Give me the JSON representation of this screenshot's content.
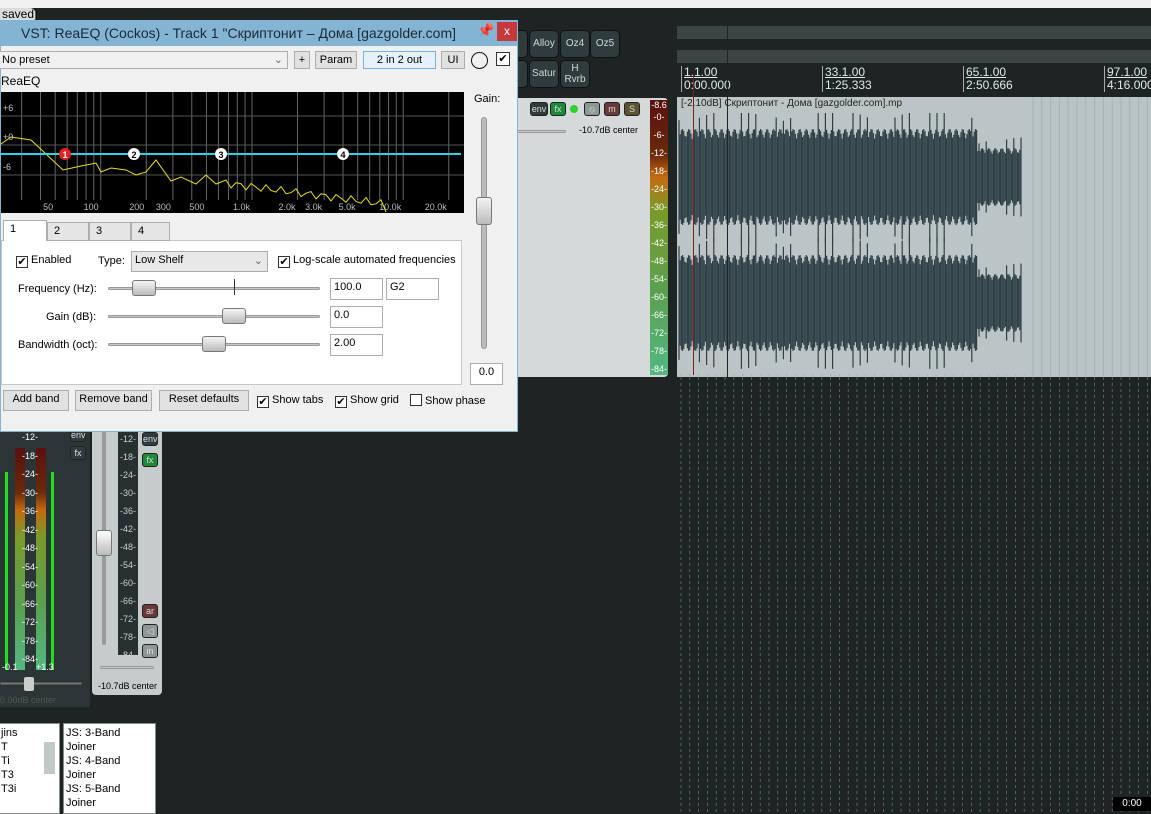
{
  "project_tab": "saved]",
  "vst": {
    "title": "VST: ReaEQ (Cockos) - Track 1 \"Скриптонит – Дома [gazgolder.com]",
    "close": "x",
    "preset": "No preset",
    "add": "+",
    "param": "Param",
    "io": "2 in 2 out",
    "ui": "UI",
    "group": "ReaEQ",
    "gain_label": "Gain:",
    "gain_value": "0.0",
    "graph": {
      "db_labels": [
        "+6",
        "+0",
        "-6"
      ],
      "freq_labels": [
        "50",
        "100",
        "200",
        "300",
        "500",
        "1.0k",
        "2.0k",
        "3.0k",
        "5.0k",
        "10.0k",
        "20.0k"
      ],
      "bands": [
        "1",
        "2",
        "3",
        "4"
      ],
      "selected_band": "1",
      "colors": {
        "eq_line": "#2ad4e8",
        "spectrum": "#e8e020",
        "selected": "#e82020"
      }
    },
    "tabs": [
      "1",
      "2",
      "3",
      "4"
    ],
    "enabled": "Enabled",
    "type_label": "Type:",
    "type_value": "Low Shelf",
    "logscale": "Log-scale automated frequencies",
    "frequency_label": "Frequency (Hz):",
    "frequency_value": "100.0",
    "note_value": "G2",
    "gain_db_label": "Gain (dB):",
    "gain_db_value": "0.0",
    "bandwidth_label": "Bandwidth (oct):",
    "bandwidth_value": "2.00",
    "add_band": "Add band",
    "remove_band": "Remove band",
    "reset": "Reset defaults",
    "show_tabs": "Show tabs",
    "show_grid": "Show grid",
    "show_phase": "Show phase",
    "checks": {
      "enabled": true,
      "logscale": true,
      "show_tabs": true,
      "show_grid": true,
      "show_phase": false
    }
  },
  "fx_buttons": [
    "Alloy",
    "Oz4",
    "Oz5",
    "Satur",
    "H Rvrb"
  ],
  "track": {
    "env": "env",
    "fx": "fx",
    "m": "m",
    "s": "S",
    "pan": "-10.7dB center",
    "peak": "-8.6",
    "meter_ticks": [
      "-0-",
      "-6-",
      "-12-",
      "-18-",
      "-24-",
      "-30-",
      "-36-",
      "-42-",
      "-48-",
      "-54-",
      "-60-",
      "-66-",
      "-72-",
      "-78-",
      "-84-"
    ]
  },
  "ruler": [
    {
      "bar": "1.1.00",
      "time": "0:00.000"
    },
    {
      "bar": "33.1.00",
      "time": "1:25.333"
    },
    {
      "bar": "65.1.00",
      "time": "2:50.666"
    },
    {
      "bar": "97.1.00",
      "time": "4:16.000"
    }
  ],
  "item_label": "[-2.10dB] Скриптонит - Дома [gazgolder.com].mp",
  "master": {
    "ticks": [
      "-12-",
      "-18-",
      "-24-",
      "-30-",
      "-36-",
      "-42-",
      "-48-",
      "-54-",
      "-60-",
      "-66-",
      "-72-",
      "-78-",
      "-84-"
    ],
    "left_peak": "-0.1",
    "right_peak": "+1.3",
    "pan": "0.00dB center",
    "env": "env",
    "fx": "fx"
  },
  "strip": {
    "ticks": [
      "-12-",
      "-18-",
      "-24-",
      "-30-",
      "-36-",
      "-42-",
      "-48-",
      "-54-",
      "-60-",
      "-66-",
      "-72-",
      "-78-",
      "-84-"
    ],
    "env": "env",
    "fx": "fx",
    "ar": "ar",
    "in": "in",
    "pan": "-10.7dB center"
  },
  "plugin_list": [
    "jins",
    "T",
    "Ti",
    "T3",
    "T3i"
  ],
  "js_list": [
    "JS: 3-Band Joiner",
    "JS: 4-Band Joiner",
    "JS: 5-Band Joiner"
  ],
  "clock": "0:00"
}
